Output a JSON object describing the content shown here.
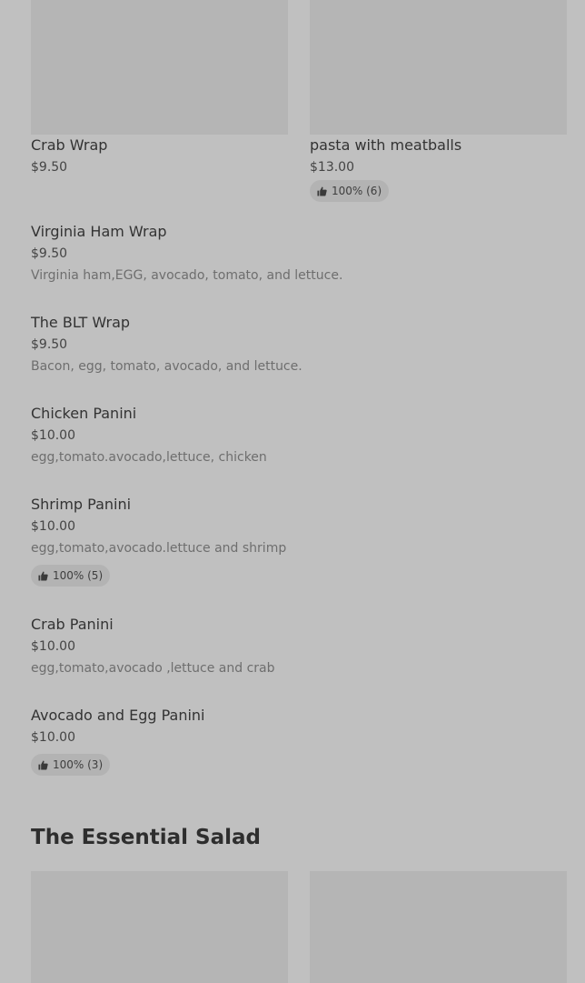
{
  "top_cards": [
    {
      "name": "Crab Wrap",
      "price": "$9.50"
    },
    {
      "name": "pasta with meatballs",
      "price": "$13.00",
      "rating": "100% (6)"
    }
  ],
  "items": [
    {
      "name": "Virginia Ham Wrap",
      "price": "$9.50",
      "description": "Virginia ham,EGG, avocado, tomato, and lettuce."
    },
    {
      "name": "The BLT Wrap",
      "price": "$9.50",
      "description": "Bacon, egg, tomato, avocado, and lettuce."
    },
    {
      "name": "Chicken Panini",
      "price": "$10.00",
      "description": "egg,tomato.avocado,lettuce, chicken"
    },
    {
      "name": "Shrimp Panini",
      "price": "$10.00",
      "description": "egg,tomato,avocado.lettuce and shrimp",
      "rating": "100% (5)"
    },
    {
      "name": "Crab Panini",
      "price": "$10.00",
      "description": "egg,tomato,avocado ,lettuce and crab"
    },
    {
      "name": "Avocado and Egg Panini",
      "price": "$10.00",
      "rating": "100% (3)"
    }
  ],
  "section": {
    "title": "The Essential Salad"
  },
  "icons": {
    "rating": "thumbs-up-icon"
  },
  "colors": {
    "background": "#c0c0c0",
    "placeholder": "#b5b5b5",
    "badge": "#b3b3b3"
  }
}
